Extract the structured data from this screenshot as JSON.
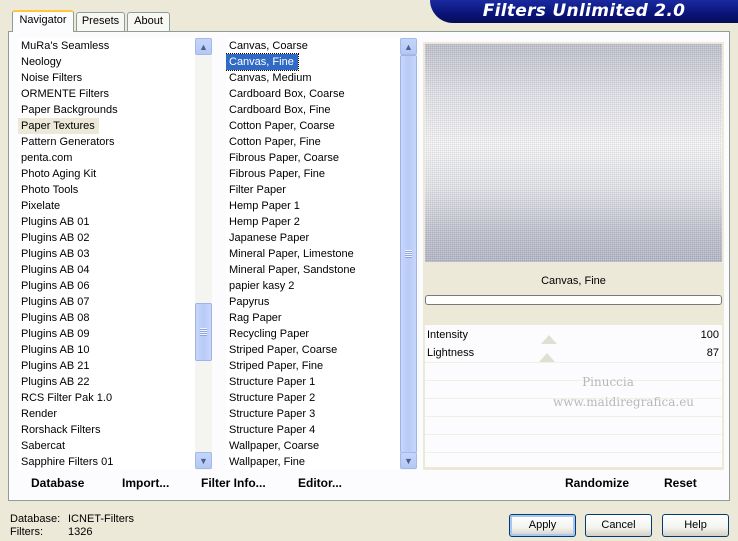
{
  "banner": {
    "title": "Filters Unlimited 2.0"
  },
  "tabs": [
    {
      "label": "Navigator",
      "active": true
    },
    {
      "label": "Presets",
      "active": false
    },
    {
      "label": "About",
      "active": false
    }
  ],
  "categories": {
    "items": [
      "MuRa's Seamless",
      "Neology",
      "Noise Filters",
      "ORMENTE Filters",
      "Paper Backgrounds",
      "Paper Textures",
      "Pattern Generators",
      "penta.com",
      "Photo Aging Kit",
      "Photo Tools",
      "Pixelate",
      "Plugins AB 01",
      "Plugins AB 02",
      "Plugins AB 03",
      "Plugins AB 04",
      "Plugins AB 06",
      "Plugins AB 07",
      "Plugins AB 08",
      "Plugins AB 09",
      "Plugins AB 10",
      "Plugins AB 21",
      "Plugins AB 22",
      "RCS Filter Pak 1.0",
      "Render",
      "Rorshack Filters",
      "Sabercat",
      "Sapphire Filters 01"
    ],
    "selected": "Paper Textures",
    "scroll_position": 0.73
  },
  "filters": {
    "items": [
      "Canvas, Coarse",
      "Canvas, Fine",
      "Canvas, Medium",
      "Cardboard Box, Coarse",
      "Cardboard Box, Fine",
      "Cotton Paper, Coarse",
      "Cotton Paper, Fine",
      "Fibrous Paper, Coarse",
      "Fibrous Paper, Fine",
      "Filter Paper",
      "Hemp Paper 1",
      "Hemp Paper 2",
      "Japanese Paper",
      "Mineral Paper, Limestone",
      "Mineral Paper, Sandstone",
      "papier kasy 2",
      "Papyrus",
      "Rag Paper",
      "Recycling Paper",
      "Striped Paper, Coarse",
      "Striped Paper, Fine",
      "Structure Paper 1",
      "Structure Paper 2",
      "Structure Paper 3",
      "Structure Paper 4",
      "Wallpaper, Coarse",
      "Wallpaper, Fine"
    ],
    "selected": "Canvas, Fine"
  },
  "preview": {
    "filter_name": "Canvas, Fine",
    "sliders": [
      {
        "label": "Intensity",
        "value": "100",
        "level": 100
      },
      {
        "label": "Lightness",
        "value": "87",
        "level": 87
      }
    ],
    "watermark_line1": "Pinuccia",
    "watermark_line2": "www.maidiregrafica.eu"
  },
  "toolbar": {
    "database": "Database",
    "import": "Import...",
    "filter_info": "Filter Info...",
    "editor": "Editor...",
    "randomize": "Randomize",
    "reset": "Reset"
  },
  "status": {
    "database_label": "Database:",
    "database_value": "ICNET-Filters",
    "filters_label": "Filters:",
    "filters_value": "1326"
  },
  "buttons": {
    "apply": "Apply",
    "cancel": "Cancel",
    "help": "Help"
  }
}
